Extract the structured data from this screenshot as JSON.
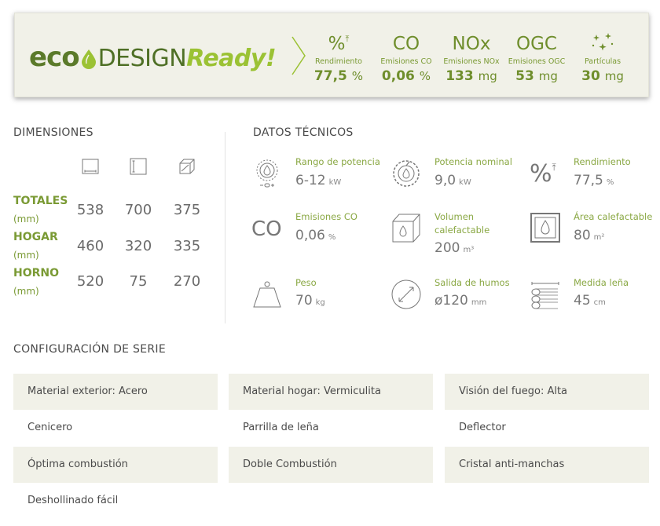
{
  "banner": {
    "logo": {
      "eco": "eco",
      "design": "DESIGN",
      "ready": "Ready!"
    },
    "stats": [
      {
        "symbol": "%",
        "label": "Rendimiento",
        "value": "77,5",
        "unit": "%"
      },
      {
        "symbol": "CO",
        "label": "Emisiones CO",
        "value": "0,06",
        "unit": "%"
      },
      {
        "symbol": "NOx",
        "label": "Emisiones NOx",
        "value": "133",
        "unit": "mg"
      },
      {
        "symbol": "OGC",
        "label": "Emisiones OGC",
        "value": "53",
        "unit": "mg"
      },
      {
        "symbol": "sparkles-icon",
        "label": "Partículas",
        "value": "30",
        "unit": "mg"
      }
    ]
  },
  "dimensions": {
    "title": "DIMENSIONES",
    "icons": [
      "width-icon",
      "height-icon",
      "depth-icon"
    ],
    "rows": [
      {
        "label": "TOTALES",
        "unit": "(mm)",
        "values": [
          "538",
          "700",
          "375"
        ]
      },
      {
        "label": "HOGAR",
        "unit": "(mm)",
        "values": [
          "460",
          "320",
          "335"
        ]
      },
      {
        "label": "HORNO",
        "unit": "(mm)",
        "values": [
          "520",
          "75",
          "270"
        ]
      }
    ]
  },
  "tech": {
    "title": "DATOS TÉCNICOS",
    "items": [
      {
        "icon": "power-range-icon",
        "label": "Rango de potencia",
        "value": "6-12",
        "unit": "kW"
      },
      {
        "icon": "nominal-power-icon",
        "label": "Potencia nominal",
        "value": "9,0",
        "unit": "kW"
      },
      {
        "icon": "efficiency-icon",
        "label": "Rendimiento",
        "value": "77,5",
        "unit": "%"
      },
      {
        "icon": "co-icon",
        "icon_text": "CO",
        "label": "Emisiones CO",
        "value": "0,06",
        "unit": "%"
      },
      {
        "icon": "volume-icon",
        "label": "Volumen calefactable",
        "value": "200",
        "unit": "m³"
      },
      {
        "icon": "area-icon",
        "label": "Área calefactable",
        "value": "80",
        "unit": "m²"
      },
      {
        "icon": "weight-icon",
        "label": "Peso",
        "value": "70",
        "unit": "kg"
      },
      {
        "icon": "flue-outlet-icon",
        "label": "Salida de humos",
        "value": "ø120",
        "unit": "mm"
      },
      {
        "icon": "log-size-icon",
        "label": "Medida leña",
        "value": "45",
        "unit": "cm"
      }
    ]
  },
  "config": {
    "title": "CONFIGURACIÓN DE SERIE",
    "items": [
      "Material exterior: Acero",
      "Material hogar: Vermiculita",
      "Visión del fuego: Alta",
      "Cenicero",
      "Parrilla de leña",
      "Deflector",
      "Óptima combustión",
      "Doble Combustión",
      "Cristal anti-manchas",
      "Deshollinado fácil"
    ]
  },
  "colors": {
    "accent": "#7a9a34",
    "brand_dark": "#4f7026",
    "brand_light": "#9bc234",
    "panel": "#f1f1e8"
  }
}
